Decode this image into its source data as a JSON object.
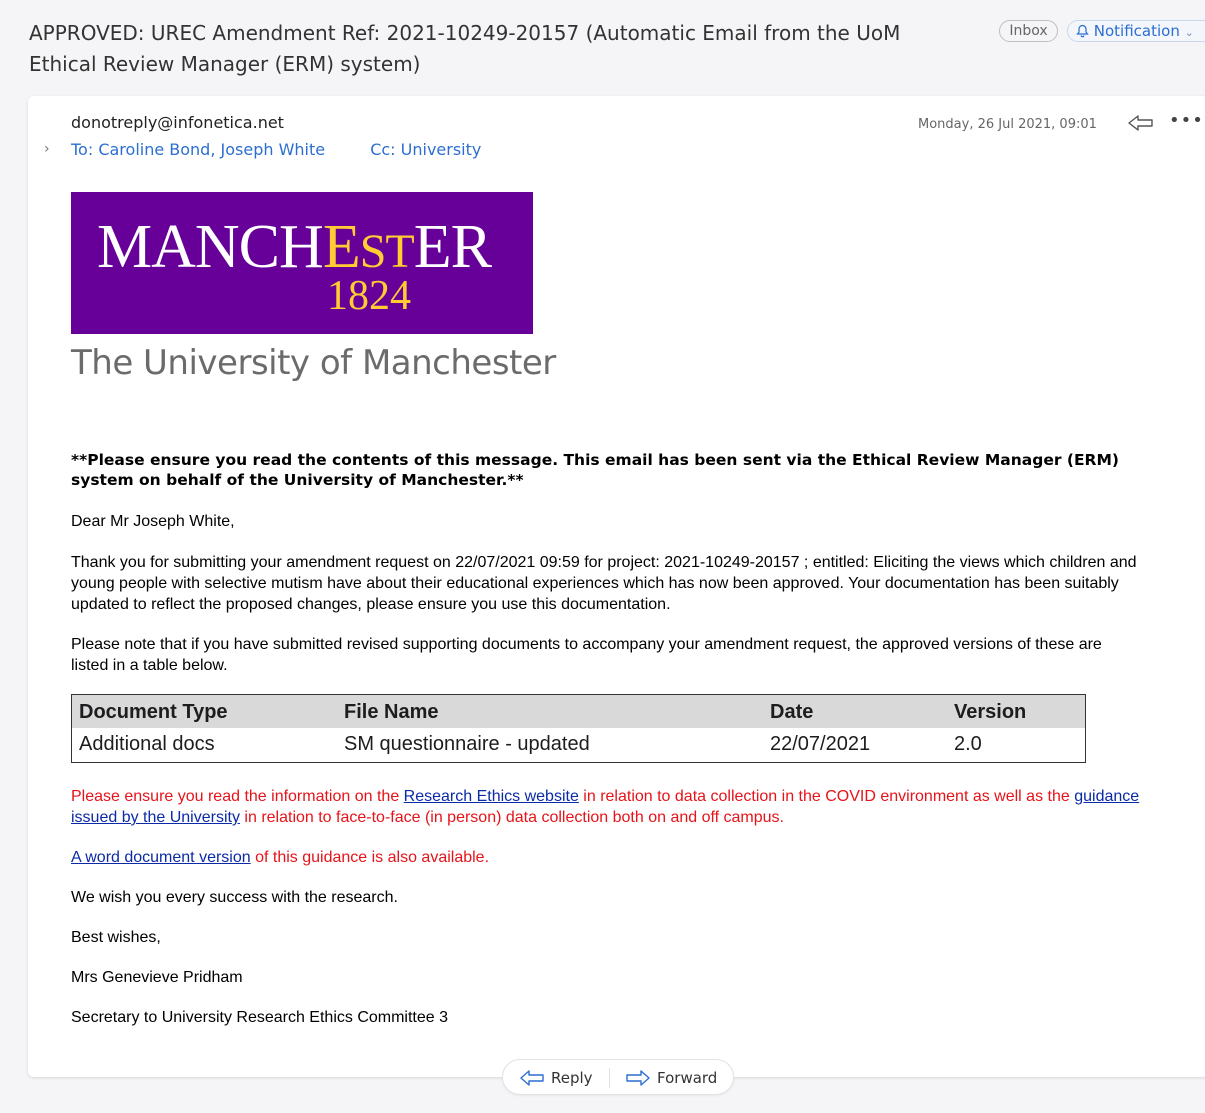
{
  "subject": "APPROVED: UREC Amendment Ref: 2021-10249-20157 (Automatic Email from the UoM Ethical Review Manager (ERM) system)",
  "labels": {
    "inbox": "Inbox",
    "notification": "Notification"
  },
  "header": {
    "sender": "donotreply@infonetica.net",
    "to": "To: Caroline Bond, Joseph White",
    "cc": "Cc: University",
    "date": "Monday, 26 Jul 2021, 09:01"
  },
  "logo": {
    "word_pre": "MANCH",
    "word_gold_1": "E",
    "word_gold_2": "S",
    "word_gold_3": "T",
    "word_post": "ER",
    "year": "1824",
    "caption": "The University of Manchester",
    "purple": "#660099",
    "gold": "#ffcc33"
  },
  "body": {
    "notice": "**Please ensure you read the contents of this message. This email has been sent via the Ethical Review Manager (ERM) system on behalf of the University of Manchester.**",
    "greeting": "Dear Mr Joseph White,",
    "thanks": "Thank you for submitting your amendment request on 22/07/2021 09:59 for project: 2021-10249-20157 ; entitled: Eliciting the views which children and young people with selective mutism have about their educational experiences which has now been approved. Your documentation has been suitably updated to reflect the proposed changes, please ensure you use this documentation.",
    "note": "Please note that if you have submitted revised supporting documents to accompany your amendment request, the approved versions of these are listed in a table below.",
    "table": {
      "headers": [
        "Document Type",
        "File Name",
        "Date",
        "Version"
      ],
      "rows": [
        [
          "Additional docs",
          "SM questionnaire - updated",
          "22/07/2021",
          "2.0"
        ]
      ]
    },
    "covid_1": "Please ensure you read the information on the ",
    "covid_link_1": "Research Ethics website",
    "covid_2": " in relation to data collection in the COVID environment as well as the ",
    "covid_link_2": "guidance issued by the University",
    "covid_3": " in relation to face-to-face (in person) data collection both on and off campus.",
    "word_link": "A word document version",
    "word_rest": " of this guidance is also available.",
    "wish": "We wish you every success with the research.",
    "best": "Best wishes,",
    "name": "Mrs Genevieve Pridham",
    "title": "Secretary to University Research Ethics Committee 3"
  },
  "footer": {
    "reply": "Reply",
    "forward": "Forward"
  },
  "colors": {
    "accent": "#2c6fd1",
    "warning_red": "#e6131a",
    "link": "#0b2aa8"
  }
}
